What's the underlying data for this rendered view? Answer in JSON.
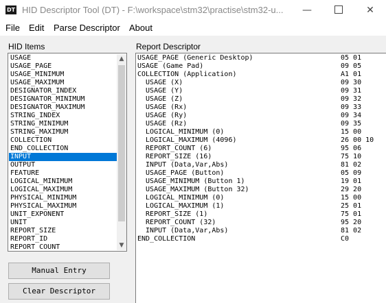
{
  "window": {
    "icon_text": "DT",
    "title": "HID Descriptor Tool (DT) - F:\\workspace\\stm32\\practise\\stm32-u...",
    "minimize": "—",
    "close": "✕"
  },
  "menu": [
    "File",
    "Edit",
    "Parse Descriptor",
    "About"
  ],
  "hid_items": {
    "label": "HID Items",
    "items": [
      "USAGE",
      "USAGE_PAGE",
      "USAGE_MINIMUM",
      "USAGE_MAXIMUM",
      "DESIGNATOR_INDEX",
      "DESIGNATOR_MINIMUM",
      "DESIGNATOR_MAXIMUM",
      "STRING_INDEX",
      "STRING_MINIMUM",
      "STRING_MAXIMUM",
      "COLLECTION",
      "END_COLLECTION",
      "INPUT",
      "OUTPUT",
      "FEATURE",
      "LOGICAL_MINIMUM",
      "LOGICAL_MAXIMUM",
      "PHYSICAL_MINIMUM",
      "PHYSICAL_MAXIMUM",
      "UNIT_EXPONENT",
      "UNIT",
      "REPORT_SIZE",
      "REPORT_ID",
      "REPORT_COUNT"
    ],
    "selected": "INPUT",
    "scroll_up": "▲",
    "scroll_down": "▼"
  },
  "buttons": {
    "manual_entry": "Manual Entry",
    "clear_descriptor": "Clear Descriptor"
  },
  "report_descriptor": {
    "label": "Report Descriptor",
    "lines": [
      {
        "text": "USAGE_PAGE (Generic Desktop)",
        "bytes": "05 01"
      },
      {
        "text": "USAGE (Game Pad)",
        "bytes": "09 05"
      },
      {
        "text": "COLLECTION (Application)",
        "bytes": "A1 01"
      },
      {
        "text": "  USAGE (X)",
        "bytes": "09 30"
      },
      {
        "text": "  USAGE (Y)",
        "bytes": "09 31"
      },
      {
        "text": "  USAGE (Z)",
        "bytes": "09 32"
      },
      {
        "text": "  USAGE (Rx)",
        "bytes": "09 33"
      },
      {
        "text": "  USAGE (Ry)",
        "bytes": "09 34"
      },
      {
        "text": "  USAGE (Rz)",
        "bytes": "09 35"
      },
      {
        "text": "  LOGICAL_MINIMUM (0)",
        "bytes": "15 00"
      },
      {
        "text": "  LOGICAL_MAXIMUM (4096)",
        "bytes": "26 00 10"
      },
      {
        "text": "  REPORT_COUNT (6)",
        "bytes": "95 06"
      },
      {
        "text": "  REPORT_SIZE (16)",
        "bytes": "75 10"
      },
      {
        "text": "  INPUT (Data,Var,Abs)",
        "bytes": "81 02"
      },
      {
        "text": "  USAGE_PAGE (Button)",
        "bytes": "05 09"
      },
      {
        "text": "  USAGE_MINIMUM (Button 1)",
        "bytes": "19 01"
      },
      {
        "text": "  USAGE_MAXIMUM (Button 32)",
        "bytes": "29 20"
      },
      {
        "text": "  LOGICAL_MINIMUM (0)",
        "bytes": "15 00"
      },
      {
        "text": "  LOGICAL_MAXIMUM (1)",
        "bytes": "25 01"
      },
      {
        "text": "  REPORT_SIZE (1)",
        "bytes": "75 01"
      },
      {
        "text": "  REPORT_COUNT (32)",
        "bytes": "95 20"
      },
      {
        "text": "  INPUT (Data,Var,Abs)",
        "bytes": "81 02"
      },
      {
        "text": "END_COLLECTION",
        "bytes": "C0"
      }
    ]
  },
  "colors": {
    "selection": "#0078d7",
    "window_bg": "#f0f0f0"
  }
}
